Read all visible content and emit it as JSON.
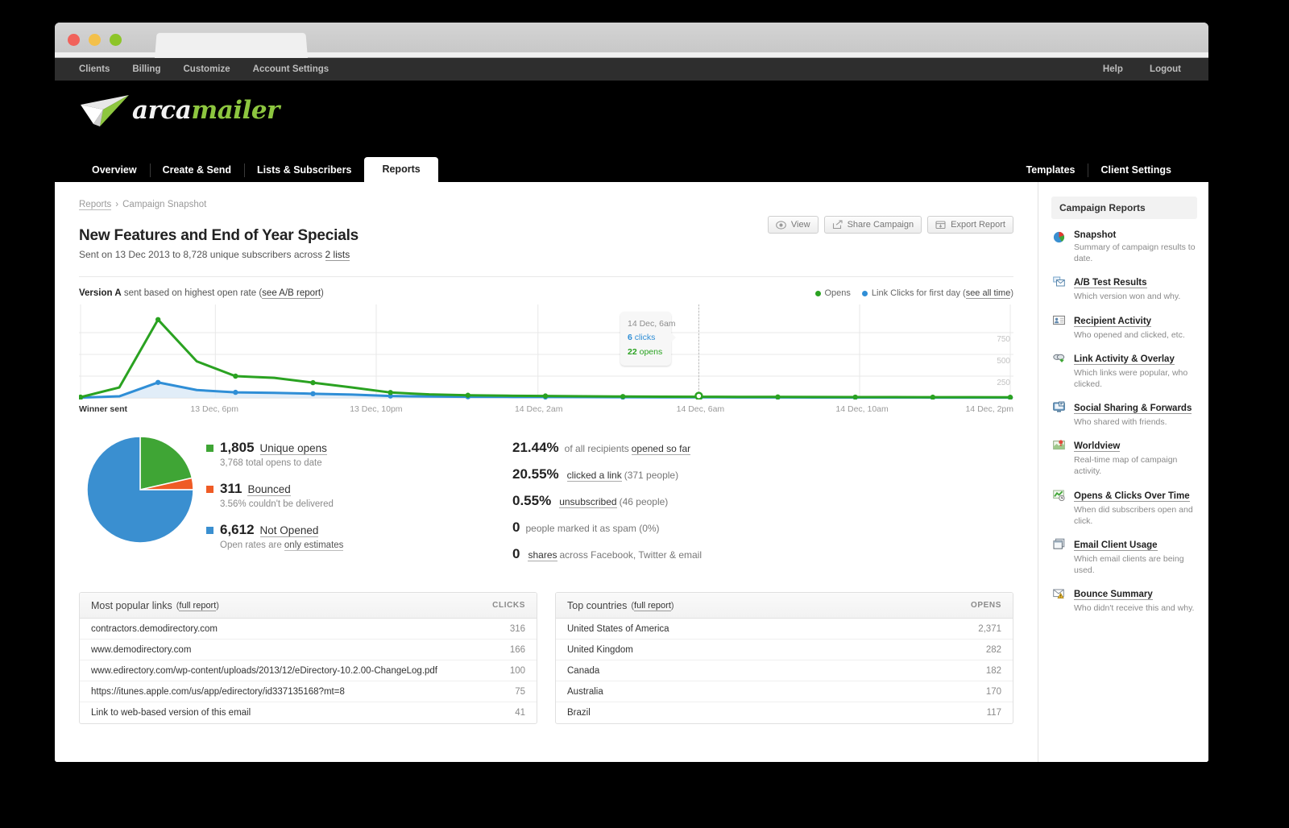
{
  "utilbar": {
    "left": [
      "Clients",
      "Billing",
      "Customize",
      "Account Settings"
    ],
    "right": [
      "Help",
      "Logout"
    ]
  },
  "brand": {
    "part1": "arca",
    "part2": "mailer"
  },
  "mainnav": {
    "left": [
      "Overview",
      "Create & Send",
      "Lists & Subscribers",
      "Reports"
    ],
    "active": "Reports",
    "right": [
      "Templates",
      "Client Settings"
    ]
  },
  "breadcrumb": {
    "root": "Reports",
    "sep": "›",
    "current": "Campaign Snapshot"
  },
  "header": {
    "title": "New Features and End of Year Specials",
    "subtitle_pre": "Sent on 13 Dec 2013 to 8,728 unique subscribers across ",
    "subtitle_link": "2 lists"
  },
  "actions": [
    {
      "label": "View",
      "icon": "eye-icon"
    },
    {
      "label": "Share Campaign",
      "icon": "share-icon"
    },
    {
      "label": "Export Report",
      "icon": "export-icon"
    }
  ],
  "ab_row": {
    "version": "Version A",
    "text": " sent based on highest open rate (",
    "link": "see A/B report",
    "close": ")"
  },
  "legend": {
    "opens": "Opens",
    "clicks": "Link Clicks for first day",
    "paren_open": "(",
    "see_all": "see all time",
    "paren_close": ")"
  },
  "chart_data": {
    "type": "line",
    "title": "",
    "xlabel": "",
    "ylabel": "",
    "ylim": [
      0,
      1000
    ],
    "yticks": [
      250,
      500,
      750
    ],
    "grid": true,
    "legend_position": "top-right",
    "x_tick_labels": [
      {
        "label": "Winner sent",
        "pos": 0
      },
      {
        "label": "13 Dec, 6pm",
        "pos": 0.145
      },
      {
        "label": "13 Dec, 10pm",
        "pos": 0.318
      },
      {
        "label": "14 Dec, 2am",
        "pos": 0.492
      },
      {
        "label": "14 Dec, 6am",
        "pos": 0.665
      },
      {
        "label": "14 Dec, 10am",
        "pos": 0.838
      },
      {
        "label": "14 Dec, 2pm",
        "pos": 1.0
      }
    ],
    "series": [
      {
        "name": "Opens",
        "color": "#2aa221",
        "values": [
          8,
          120,
          900,
          420,
          250,
          230,
          175,
          120,
          62,
          40,
          30,
          25,
          22,
          18,
          16,
          14,
          13,
          12,
          11,
          10,
          9,
          9,
          8,
          8,
          7
        ]
      },
      {
        "name": "Link Clicks for first day",
        "color": "#2f8ed6",
        "values": [
          3,
          18,
          178,
          90,
          64,
          58,
          48,
          38,
          22,
          16,
          13,
          11,
          10,
          9,
          8,
          7,
          7,
          6,
          6,
          5,
          5,
          5,
          4,
          4,
          4
        ]
      }
    ],
    "tooltip": {
      "date": "14 Dec, 6am",
      "clicks_value": "6",
      "clicks_label": "clicks",
      "opens_value": "22",
      "opens_label": "opens"
    }
  },
  "pie": {
    "type": "pie",
    "slices": [
      {
        "label": "Unique opens",
        "value": 1805,
        "percent": 21.44,
        "color": "#3fa535"
      },
      {
        "label": "Bounced",
        "value": 311,
        "percent": 3.56,
        "color": "#ef5b25"
      },
      {
        "label": "Not Opened",
        "value": 6612,
        "percent": 75.0,
        "color": "#3a8fd0"
      }
    ]
  },
  "legend_stats": [
    {
      "value": "1,805",
      "label": "Unique opens",
      "sub_pre": "3,768 total opens to date",
      "sub_link": "",
      "sub_post": "",
      "color_class": "green"
    },
    {
      "value": "311",
      "label": "Bounced",
      "sub_pre": "3.56% couldn't be delivered",
      "sub_link": "",
      "sub_post": "",
      "color_class": "orange"
    },
    {
      "value": "6,612",
      "label": "Not Opened",
      "sub_pre": "Open rates are ",
      "sub_link": "only estimates",
      "sub_post": "",
      "color_class": "blue"
    }
  ],
  "percent_stats": [
    {
      "big": "21.44%",
      "pre": "of all recipients ",
      "link": "opened so far",
      "post": ""
    },
    {
      "big": "20.55%",
      "pre": "",
      "link": "clicked a link",
      "post": " (371 people)"
    },
    {
      "big": "0.55%",
      "pre": "",
      "link": "unsubscribed",
      "post": " (46 people)"
    },
    {
      "big": "0",
      "pre": "people marked it as spam (0%)",
      "link": "",
      "post": ""
    },
    {
      "big": "0",
      "pre": "",
      "link": "shares",
      "post": " across Facebook, Twitter & email"
    }
  ],
  "links_table": {
    "title": "Most popular links",
    "full_report": "full report",
    "column": "CLICKS",
    "rows": [
      {
        "name": "contractors.demodirectory.com",
        "value": "316"
      },
      {
        "name": "www.demodirectory.com",
        "value": "166"
      },
      {
        "name": "www.edirectory.com/wp-content/uploads/2013/12/eDirectory-10.2.00-ChangeLog.pdf",
        "value": "100"
      },
      {
        "name": "https://itunes.apple.com/us/app/edirectory/id337135168?mt=8",
        "value": "75"
      },
      {
        "name": "Link to web-based version of this email",
        "value": "41"
      }
    ]
  },
  "countries_table": {
    "title": "Top countries",
    "full_report": "full report",
    "column": "OPENS",
    "rows": [
      {
        "name": "United States of America",
        "value": "2,371"
      },
      {
        "name": "United Kingdom",
        "value": "282"
      },
      {
        "name": "Canada",
        "value": "182"
      },
      {
        "name": "Australia",
        "value": "170"
      },
      {
        "name": "Brazil",
        "value": "117"
      }
    ]
  },
  "rail": {
    "heading": "Campaign Reports",
    "items": [
      {
        "title": "Snapshot",
        "desc": "Summary of campaign results to date.",
        "icon": "pie-chart-icon",
        "is_link": false
      },
      {
        "title": "A/B Test Results",
        "desc": "Which version won and why.",
        "icon": "envelopes-icon",
        "is_link": true
      },
      {
        "title": "Recipient Activity",
        "desc": "Who opened and clicked, etc.",
        "icon": "contact-card-icon",
        "is_link": true
      },
      {
        "title": "Link Activity & Overlay",
        "desc": "Which links were popular, who clicked.",
        "icon": "link-icon",
        "is_link": true
      },
      {
        "title": "Social Sharing & Forwards",
        "desc": "Who shared with friends.",
        "icon": "monitor-share-icon",
        "is_link": true
      },
      {
        "title": "Worldview",
        "desc": "Real-time map of campaign activity.",
        "icon": "map-pin-icon",
        "is_link": true
      },
      {
        "title": "Opens & Clicks Over Time",
        "desc": "When did subscribers open and click.",
        "icon": "trend-clock-icon",
        "is_link": true
      },
      {
        "title": "Email Client Usage",
        "desc": "Which email clients are being used.",
        "icon": "windows-icon",
        "is_link": true
      },
      {
        "title": "Bounce Summary",
        "desc": "Who didn't receive this and why.",
        "icon": "warning-mail-icon",
        "is_link": true
      }
    ]
  }
}
